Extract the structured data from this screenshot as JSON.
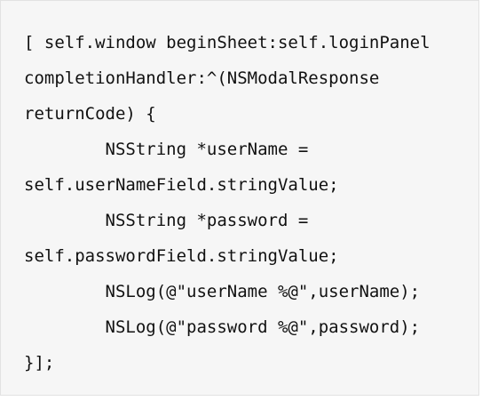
{
  "code": {
    "lines": [
      "[ self.window beginSheet:self.loginPanel",
      "completionHandler:^(NSModalResponse",
      "returnCode) {",
      "        NSString *userName =",
      "self.userNameField.stringValue;",
      "        NSString *password =",
      "self.passwordField.stringValue;",
      "        NSLog(@\"userName %@\",userName);",
      "        NSLog(@\"password %@\",password);",
      "}];"
    ]
  }
}
